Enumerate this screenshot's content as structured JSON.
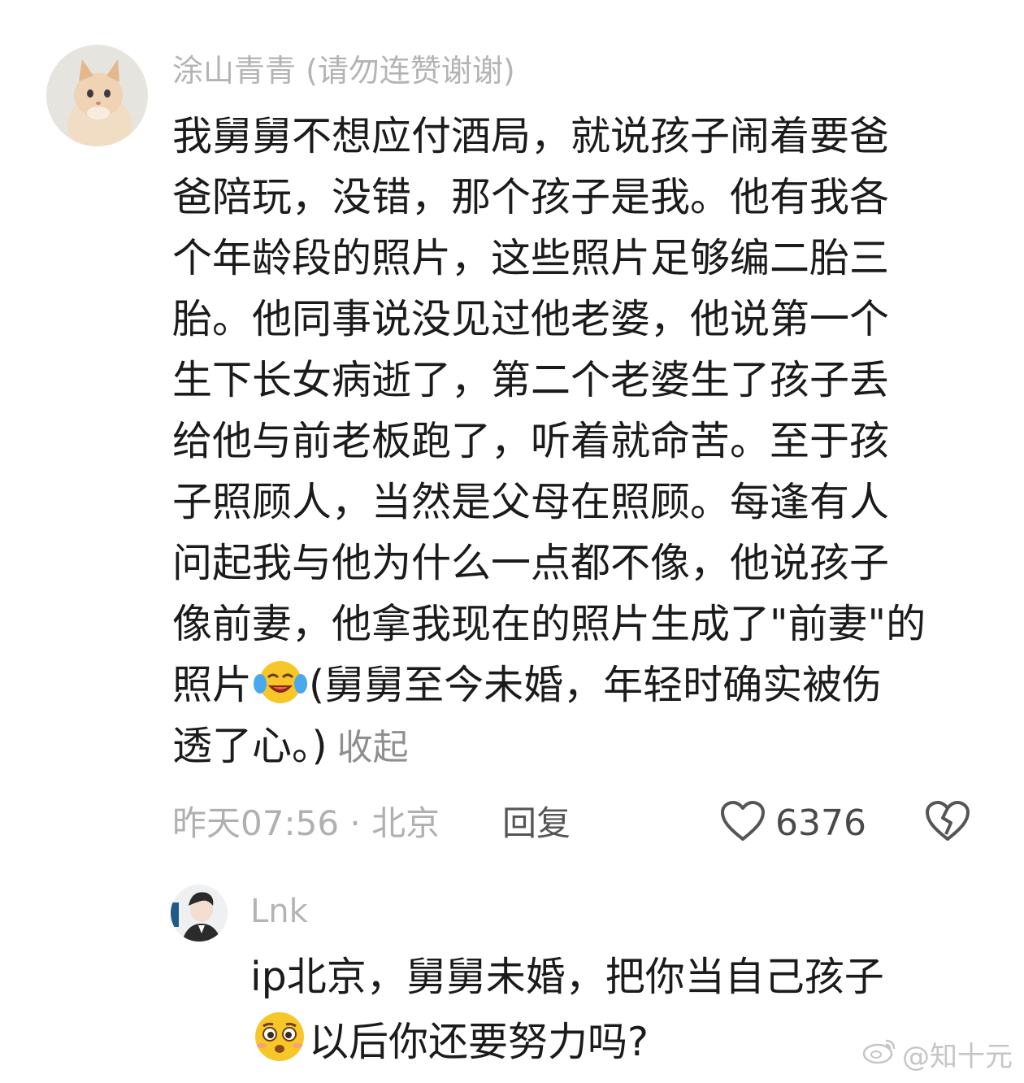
{
  "comment": {
    "username": "涂山青青 (请勿连赞谢谢)",
    "lines": [
      "我舅舅不想应付酒局，就说孩子闹着要爸",
      "爸陪玩，没错，那个孩子是我。他有我各",
      "个年龄段的照片，这些照片足够编二胎三",
      "胎。他同事说没见过他老婆，他说第一个",
      "生下长女病逝了，第二个老婆生了孩子丢",
      "给他与前老板跑了，听着就命苦。至于孩",
      "子照顾人，当然是父母在照顾。每逢有人",
      "问起我与他为什么一点都不像，他说孩子",
      "像前妻，他拿我现在的照片生成了\"前妻\"的"
    ],
    "line10_before": "照片",
    "line10_after": "(舅舅至今未婚，年轻时确实被伤",
    "line11": "透了心。)",
    "collapse_label": "收起",
    "time_location": "昨天07:56 · 北京",
    "reply_label": "回复",
    "like_count": "6376",
    "emoji_icon": "laughing-crying-face-icon"
  },
  "reply": {
    "username": "Lnk",
    "line1": "ip北京，舅舅未婚，把你当自己孩子",
    "line2": "以后你还要努力吗?",
    "emoji_icon": "pleading-face-icon"
  },
  "watermark": "@知十元",
  "colors": {
    "username": "#b4b4b4",
    "body": "#1b1b1b",
    "meta": "#b0b0b0",
    "emoji": "#f7c72a"
  }
}
